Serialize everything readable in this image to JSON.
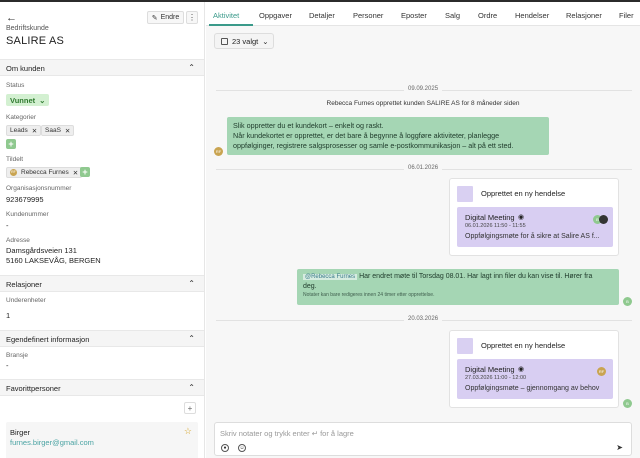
{
  "company": {
    "type_label": "Bedriftskunde",
    "name": "SALIRE AS",
    "edit_label": "Endre"
  },
  "sections": {
    "about": "Om kunden",
    "relations": "Relasjoner",
    "custom": "Egendefinert informasjon",
    "favorites": "Favorittpersoner"
  },
  "fields": {
    "status_label": "Status",
    "status_value": "Vunnet",
    "categories_label": "Kategorier",
    "categories": [
      "Leads",
      "SaaS"
    ],
    "assigned_label": "Tildelt",
    "assigned_user": "Rebecca Furnes",
    "assigned_initials": "RF",
    "orgnr_label": "Organisasjonsnummer",
    "orgnr": "923679995",
    "custnr_label": "Kundenummer",
    "custnr": "-",
    "address_label": "Adresse",
    "address_line1": "Damsgårdsveien 131",
    "address_line2": "5160 LAKSEVÅG, BERGEN",
    "subunits_label": "Underenheter",
    "subunits": "1",
    "industry_label": "Bransje",
    "industry": "-"
  },
  "favorite": {
    "name": "Birger",
    "email": "furnes.birger@gmail.com"
  },
  "tabs": [
    "Aktivitet",
    "Oppgaver",
    "Detaljer",
    "Personer",
    "Eposter",
    "Salg",
    "Ordre",
    "Hendelser",
    "Relasjoner",
    "Filer"
  ],
  "filter": {
    "label": "23 valgt"
  },
  "feed": {
    "date1": "09.09.2025",
    "sys_msg": "Rebecca Furnes opprettet kunden  SALIRE AS  for 8 måneder siden",
    "welcome_line1": "Slik oppretter du et kundekort – enkelt og raskt.",
    "welcome_line2": "Når kundekortet er opprettet, er det bare å begynne å loggføre aktiviteter, planlegge",
    "welcome_line3": "oppfølginger, registrere salgsprosesser og samle e-postkommunikasjon – alt på ett sted.",
    "welcome_avatar": "RF",
    "date2": "06.01.2026",
    "event1": {
      "title": "Opprettet en ny hendelse",
      "name": "Digital Meeting",
      "time": "06.01.2026 11:50 - 11:55",
      "desc": "Oppfølgingsmøte for å sikre at Salire AS f...",
      "avatar": "B"
    },
    "note": {
      "mention": "@Rebecca Furnes",
      "text": " Har endret møte til Torsdag 08.01. Har lagt inn filer du kan vise til. Hører fra",
      "text2": "deg.",
      "hint": "Notater kan bare redigeres innen 24 timer etter opprettelse.",
      "avatar": "B"
    },
    "date3": "20.03.2026",
    "event2": {
      "title": "Opprettet en ny hendelse",
      "name": "Digital Meeting",
      "time": "27.03.2026 11:00 - 12:00",
      "desc": "Oppfølgingsmøte – gjennomgang av behov",
      "avatar": "RF",
      "owner_avatar": "B"
    }
  },
  "composer": {
    "placeholder": "Skriv notater og trykk enter ↵ for å lagre"
  },
  "colors": {
    "accent": "#3a9a8a",
    "bubble": "#a5d6b4",
    "event": "#d8cef2",
    "status": "#d3f0d1"
  }
}
